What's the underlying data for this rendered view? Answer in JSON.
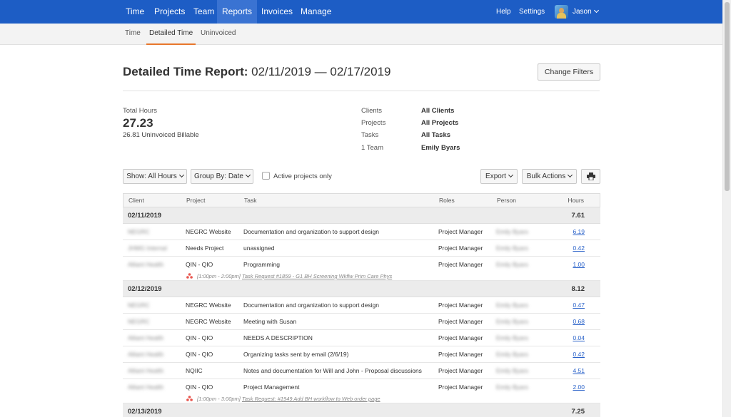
{
  "nav": {
    "items": [
      "Time",
      "Projects",
      "Team",
      "Reports",
      "Invoices",
      "Manage"
    ],
    "help": "Help",
    "settings": "Settings",
    "user": "Jason"
  },
  "subnav": {
    "items": [
      "Time",
      "Detailed Time",
      "Uninvoiced"
    ]
  },
  "header": {
    "title_prefix": "Detailed Time Report:",
    "date_range": "02/11/2019 — 02/17/2019",
    "change_filters": "Change Filters"
  },
  "summary": {
    "total_label": "Total Hours",
    "total_value": "27.23",
    "uninvoiced": "26.81 Uninvoiced Billable",
    "meta": [
      {
        "key": "Clients",
        "value": "All Clients"
      },
      {
        "key": "Projects",
        "value": "All Projects"
      },
      {
        "key": "Tasks",
        "value": "All Tasks"
      },
      {
        "key": "1 Team",
        "value": "Emily Byars"
      }
    ]
  },
  "toolbar": {
    "show": "Show: All Hours",
    "group": "Group By: Date",
    "active_only": "Active projects only",
    "export": "Export",
    "bulk": "Bulk Actions"
  },
  "table": {
    "headers": [
      "Client",
      "Project",
      "Task",
      "Roles",
      "Person",
      "Hours"
    ],
    "groups": [
      {
        "date": "02/11/2019",
        "total": "7.61",
        "rows": [
          {
            "client": "NEGRC",
            "project": "NEGRC Website",
            "task": "Documentation and organization to support design",
            "role": "Project Manager",
            "person": "Emily Byars",
            "hours": "6.19"
          },
          {
            "client": "JHMG Internal",
            "project": "Needs Project",
            "task": "unassigned",
            "role": "Project Manager",
            "person": "Emily Byars",
            "hours": "0.42"
          },
          {
            "client": "Alliant Health",
            "project": "QIN - QIO",
            "task": "Programming",
            "role": "Project Manager",
            "person": "Emily Byars",
            "hours": "1.00",
            "note_time": "[1:00pm - 2:00pm]",
            "note_text": "Task Request #1859 - G1 BH Screening Wkflw Prim Care Phys"
          }
        ]
      },
      {
        "date": "02/12/2019",
        "total": "8.12",
        "rows": [
          {
            "client": "NEGRC",
            "project": "NEGRC Website",
            "task": "Documentation and organization to support design",
            "role": "Project Manager",
            "person": "Emily Byars",
            "hours": "0.47"
          },
          {
            "client": "NEGRC",
            "project": "NEGRC Website",
            "task": "Meeting with Susan",
            "role": "Project Manager",
            "person": "Emily Byars",
            "hours": "0.68"
          },
          {
            "client": "Alliant Health",
            "project": "QIN - QIO",
            "task": "NEEDS A DESCRIPTION",
            "role": "Project Manager",
            "person": "Emily Byars",
            "hours": "0.04"
          },
          {
            "client": "Alliant Health",
            "project": "QIN - QIO",
            "task": "Organizing tasks sent by email (2/6/19)",
            "role": "Project Manager",
            "person": "Emily Byars",
            "hours": "0.42"
          },
          {
            "client": "Alliant Health",
            "project": "NQIIC",
            "task": "Notes and documentation for Will and John - Proposal discussions",
            "role": "Project Manager",
            "person": "Emily Byars",
            "hours": "4.51"
          },
          {
            "client": "Alliant Health",
            "project": "QIN - QIO",
            "task": "Project Management",
            "role": "Project Manager",
            "person": "Emily Byars",
            "hours": "2.00",
            "note_time": "[1:00pm - 3:00pm]",
            "note_text": "Task Request: #1949 Add BH workflow to Web order page"
          }
        ]
      },
      {
        "date": "02/13/2019",
        "total": "7.25",
        "rows": []
      }
    ]
  },
  "colors": {
    "nav_bg": "#1d5dc5",
    "nav_active": "#3a73d2",
    "accent": "#e8772b",
    "link": "#2a62c9"
  }
}
